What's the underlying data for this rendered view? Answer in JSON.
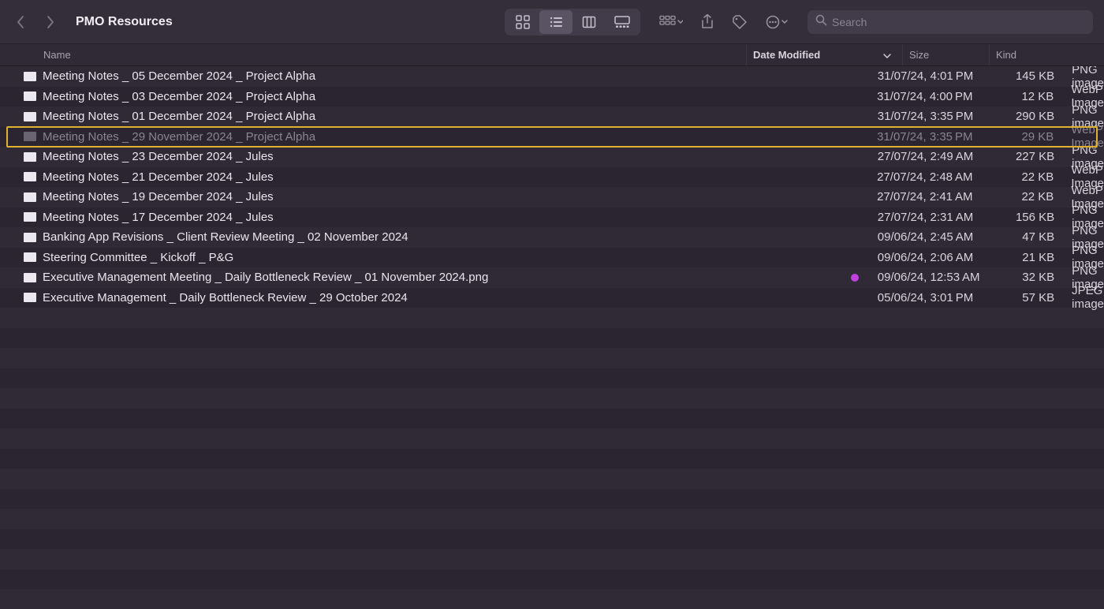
{
  "window": {
    "title": "PMO Resources",
    "search_placeholder": "Search"
  },
  "columns": {
    "name": "Name",
    "date_modified": "Date Modified",
    "size": "Size",
    "kind": "Kind"
  },
  "files": [
    {
      "name": "Meeting Notes _ 05 December 2024 _ Project Alpha",
      "date": "31/07/24, 4:01 PM",
      "size": "145 KB",
      "kind": "PNG image",
      "selected": false,
      "tag": null
    },
    {
      "name": "Meeting Notes _ 03 December 2024 _ Project Alpha",
      "date": "31/07/24, 4:00 PM",
      "size": "12 KB",
      "kind": "WebP Image",
      "selected": false,
      "tag": null
    },
    {
      "name": "Meeting Notes _ 01 December 2024 _ Project Alpha",
      "date": "31/07/24, 3:35 PM",
      "size": "290 KB",
      "kind": "PNG image",
      "selected": false,
      "tag": null
    },
    {
      "name": "Meeting Notes _ 29 November 2024 _ Project Alpha",
      "date": "31/07/24, 3:35 PM",
      "size": "29 KB",
      "kind": "WebP Image",
      "selected": true,
      "tag": null
    },
    {
      "name": "Meeting Notes _ 23 December 2024 _ Jules",
      "date": "27/07/24, 2:49 AM",
      "size": "227 KB",
      "kind": "PNG image",
      "selected": false,
      "tag": null
    },
    {
      "name": "Meeting Notes _ 21 December 2024 _ Jules",
      "date": "27/07/24, 2:48 AM",
      "size": "22 KB",
      "kind": "WebP Image",
      "selected": false,
      "tag": null
    },
    {
      "name": "Meeting Notes _ 19 December 2024 _ Jules",
      "date": "27/07/24, 2:41 AM",
      "size": "22 KB",
      "kind": "WebP Image",
      "selected": false,
      "tag": null
    },
    {
      "name": "Meeting Notes _ 17 December 2024 _ Jules",
      "date": "27/07/24, 2:31 AM",
      "size": "156 KB",
      "kind": "PNG image",
      "selected": false,
      "tag": null
    },
    {
      "name": "Banking App Revisions _ Client Review Meeting _ 02 November 2024",
      "date": "09/06/24, 2:45 AM",
      "size": "47 KB",
      "kind": "PNG image",
      "selected": false,
      "tag": null
    },
    {
      "name": "Steering Committee _ Kickoff _ P&G",
      "date": "09/06/24, 2:06 AM",
      "size": "21 KB",
      "kind": "PNG image",
      "selected": false,
      "tag": null
    },
    {
      "name": "Executive Management Meeting _ Daily Bottleneck Review _ 01 November 2024.png",
      "date": "09/06/24, 12:53 AM",
      "size": "32 KB",
      "kind": "PNG image",
      "selected": false,
      "tag": "#c040e0"
    },
    {
      "name": "Executive Management _ Daily Bottleneck Review _ 29 October 2024",
      "date": "05/06/24, 3:01 PM",
      "size": "57 KB",
      "kind": "JPEG image",
      "selected": false,
      "tag": null
    }
  ],
  "empty_rows": 15
}
